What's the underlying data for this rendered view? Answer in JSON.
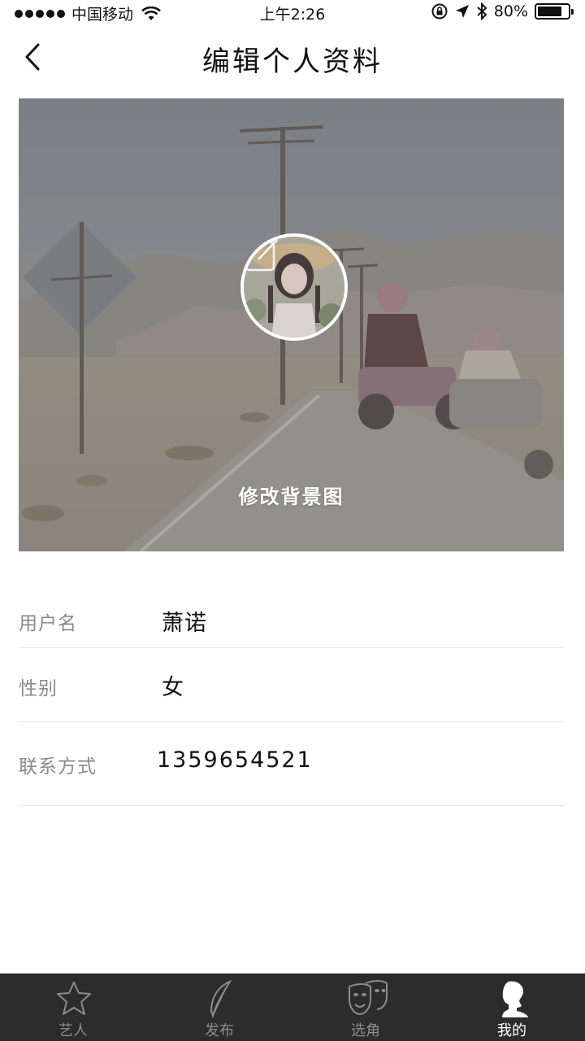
{
  "status_bar": {
    "carrier": "中国移动",
    "time": "上午2:26",
    "battery_text": "80%",
    "battery_level": 0.8,
    "icons": [
      "signal-dots",
      "wifi-icon",
      "orientation-lock-icon",
      "location-icon",
      "bluetooth-icon",
      "battery-icon"
    ]
  },
  "nav": {
    "back_icon": "chevron-left-icon",
    "title": "编辑个人资料"
  },
  "banner": {
    "edit_background_label": "修改背景图",
    "avatar_edit_icon": "edit-icon"
  },
  "profile": {
    "username_label": "用户名",
    "username_value": "萧诺",
    "gender_label": "性别",
    "gender_value": "女",
    "contact_label": "联系方式",
    "contact_value": "1359654521"
  },
  "tabbar": {
    "active_tab": "我的",
    "tabs": [
      {
        "label": "艺人",
        "icon": "star-icon"
      },
      {
        "label": "发布",
        "icon": "feather-icon"
      },
      {
        "label": "选角",
        "icon": "mask-icon"
      },
      {
        "label": "我的",
        "icon": "profile-silhouette-icon"
      }
    ]
  }
}
